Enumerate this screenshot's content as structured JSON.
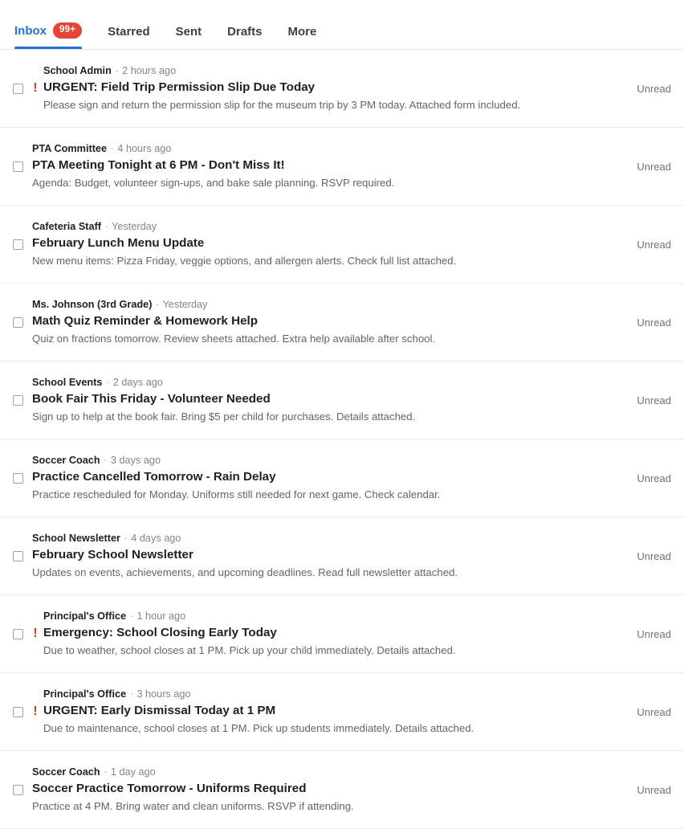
{
  "tabs": [
    {
      "label": "Inbox",
      "active": true,
      "badge": "99+"
    },
    {
      "label": "Starred",
      "active": false,
      "badge": null
    },
    {
      "label": "Sent",
      "active": false,
      "badge": null
    },
    {
      "label": "Drafts",
      "active": false,
      "badge": null
    },
    {
      "label": "More",
      "active": false,
      "badge": null
    }
  ],
  "colors": {
    "accent": "#1a73e8",
    "badge": "#ea4335",
    "urgent": "#ea3323",
    "subject": "#202124",
    "muted": "#5f6368",
    "status": "#6b7280",
    "divider": "#ececee"
  },
  "separator": "·",
  "urgent_glyph": "!",
  "emails": [
    {
      "sender": "School Admin",
      "time": "2 hours ago",
      "subject": "URGENT: Field Trip Permission Slip Due Today",
      "preview": "Please sign and return the permission slip for the museum trip by 3 PM today. Attached form included.",
      "status": "Unread",
      "urgent": true,
      "checked": false
    },
    {
      "sender": "PTA Committee",
      "time": "4 hours ago",
      "subject": "PTA Meeting Tonight at 6 PM - Don't Miss It!",
      "preview": "Agenda: Budget, volunteer sign-ups, and bake sale planning. RSVP required.",
      "status": "Unread",
      "urgent": false,
      "checked": false
    },
    {
      "sender": "Cafeteria Staff",
      "time": "Yesterday",
      "subject": "February Lunch Menu Update",
      "preview": "New menu items: Pizza Friday, veggie options, and allergen alerts. Check full list attached.",
      "status": "Unread",
      "urgent": false,
      "checked": false
    },
    {
      "sender": "Ms. Johnson (3rd Grade)",
      "time": "Yesterday",
      "subject": "Math Quiz Reminder & Homework Help",
      "preview": "Quiz on fractions tomorrow. Review sheets attached. Extra help available after school.",
      "status": "Unread",
      "urgent": false,
      "checked": false
    },
    {
      "sender": "School Events",
      "time": "2 days ago",
      "subject": "Book Fair This Friday - Volunteer Needed",
      "preview": "Sign up to help at the book fair. Bring $5 per child for purchases. Details attached.",
      "status": "Unread",
      "urgent": false,
      "checked": false
    },
    {
      "sender": "Soccer Coach",
      "time": "3 days ago",
      "subject": "Practice Cancelled Tomorrow - Rain Delay",
      "preview": "Practice rescheduled for Monday. Uniforms still needed for next game. Check calendar.",
      "status": "Unread",
      "urgent": false,
      "checked": false
    },
    {
      "sender": "School Newsletter",
      "time": "4 days ago",
      "subject": "February School Newsletter",
      "preview": "Updates on events, achievements, and upcoming deadlines. Read full newsletter attached.",
      "status": "Unread",
      "urgent": false,
      "checked": false
    },
    {
      "sender": "Principal's Office",
      "time": "1 hour ago",
      "subject": "Emergency: School Closing Early Today",
      "preview": "Due to weather, school closes at 1 PM. Pick up your child immediately. Details attached.",
      "status": "Unread",
      "urgent": true,
      "checked": false
    },
    {
      "sender": "Principal's Office",
      "time": "3 hours ago",
      "subject": "URGENT: Early Dismissal Today at 1 PM",
      "preview": "Due to maintenance, school closes at 1 PM. Pick up students immediately. Details attached.",
      "status": "Unread",
      "urgent": true,
      "checked": false
    },
    {
      "sender": "Soccer Coach",
      "time": "1 day ago",
      "subject": "Soccer Practice Tomorrow - Uniforms Required",
      "preview": "Practice at 4 PM. Bring water and clean uniforms. RSVP if attending.",
      "status": "Unread",
      "urgent": false,
      "checked": false
    }
  ]
}
